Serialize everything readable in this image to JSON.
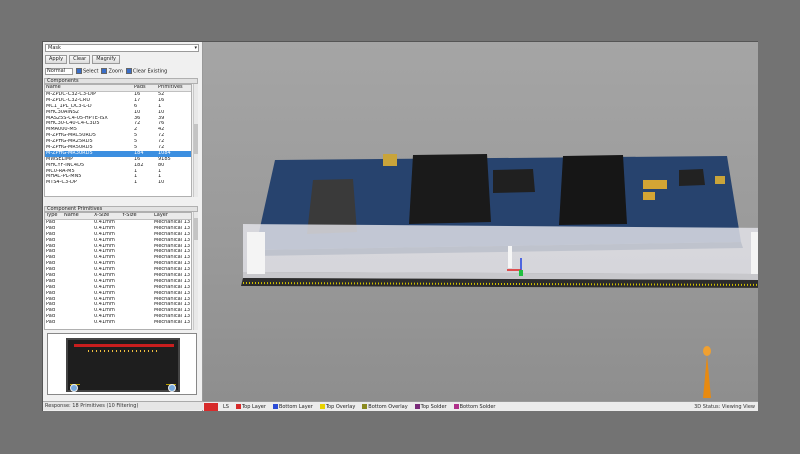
{
  "filter": {
    "mode": "Mask"
  },
  "buttons": {
    "apply": "Apply",
    "clear": "Clear",
    "magnify": "Magnify"
  },
  "mask": {
    "label": "Normal",
    "select": "Select",
    "zoom": "Zoom",
    "clear_existing": "Clear Existing"
  },
  "components": {
    "title": "Components",
    "headers": [
      "Name",
      "Pads",
      "Primitives"
    ],
    "rows": [
      [
        "M-ZPDC-C32-C3-DIP",
        "16",
        "52"
      ],
      [
        "M-ZPDC-C32-CRU",
        "17",
        "16"
      ],
      [
        "MC1_1PL_DC3-L-D",
        "6",
        "1"
      ],
      [
        "MHC30AINS2",
        "10",
        "10"
      ],
      [
        "MAS25S-C4-05-HPTE-ISX",
        "36",
        "39"
      ],
      [
        "MHC30-C40-C4-C3D5",
        "72",
        "76"
      ],
      [
        "MMA000-M5",
        "2",
        "42"
      ],
      [
        "M-ZPHG-MRC50RD5",
        "5",
        "72"
      ],
      [
        "M-ZPHG-MR25RD5",
        "5",
        "72"
      ],
      [
        "M-ZPHG-MR50RD5",
        "5",
        "72"
      ],
      [
        "M-ZPHG-MR30RD5",
        "184",
        "1084"
      ],
      [
        "MWSELIMP",
        "16",
        "9185"
      ],
      [
        "MHCYF-INC4D5",
        "182",
        "80"
      ],
      [
        "MC0-RA-M5",
        "1",
        "1"
      ],
      [
        "MHAC-PL-MN5",
        "1",
        "1"
      ],
      [
        "MTS4-C3-DP",
        "1",
        "10"
      ]
    ],
    "selected_index": 10
  },
  "primitives": {
    "title": "Component Primitives",
    "headers": [
      "Type",
      "Name",
      "X-Size",
      "Y-Size",
      "Layer"
    ],
    "rows": [
      [
        "Pad",
        "",
        "0.41mm",
        "",
        "Mechanical 13"
      ],
      [
        "Pad",
        "",
        "0.41mm",
        "",
        "Mechanical 13"
      ],
      [
        "Pad",
        "",
        "0.41mm",
        "",
        "Mechanical 13"
      ],
      [
        "Pad",
        "",
        "0.41mm",
        "",
        "Mechanical 13"
      ],
      [
        "Pad",
        "",
        "0.41mm",
        "",
        "Mechanical 13"
      ],
      [
        "Pad",
        "",
        "0.41mm",
        "",
        "Mechanical 13"
      ],
      [
        "Pad",
        "",
        "0.41mm",
        "",
        "Mechanical 13"
      ],
      [
        "Pad",
        "",
        "0.41mm",
        "",
        "Mechanical 13"
      ],
      [
        "Pad",
        "",
        "0.41mm",
        "",
        "Mechanical 13"
      ],
      [
        "Pad",
        "",
        "0.41mm",
        "",
        "Mechanical 13"
      ],
      [
        "Pad",
        "",
        "0.41mm",
        "",
        "Mechanical 13"
      ],
      [
        "Pad",
        "",
        "0.41mm",
        "",
        "Mechanical 13"
      ],
      [
        "Pad",
        "",
        "0.41mm",
        "",
        "Mechanical 13"
      ],
      [
        "Pad",
        "",
        "0.41mm",
        "",
        "Mechanical 13"
      ],
      [
        "Pad",
        "",
        "0.41mm",
        "",
        "Mechanical 13"
      ],
      [
        "Pad",
        "",
        "0.41mm",
        "",
        "Mechanical 13"
      ],
      [
        "Pad",
        "",
        "0.41mm",
        "",
        "Mechanical 13"
      ],
      [
        "Pad",
        "",
        "0.41mm",
        "",
        "Mechanical 13"
      ]
    ]
  },
  "status": "Response: 18 Primitives (10 Filtering)",
  "layers": [
    {
      "label": "Top Layer",
      "color": "#d72b2b"
    },
    {
      "label": "Bottom Layer",
      "color": "#2b4bd7"
    },
    {
      "label": "Top Overlay",
      "color": "#e8d200"
    },
    {
      "label": "Bottom Overlay",
      "color": "#8a8a20"
    },
    {
      "label": "Top Solder",
      "color": "#7a2b7a"
    },
    {
      "label": "Bottom Solder",
      "color": "#b0308a"
    }
  ],
  "view_status": "3D Status: Viewing View"
}
